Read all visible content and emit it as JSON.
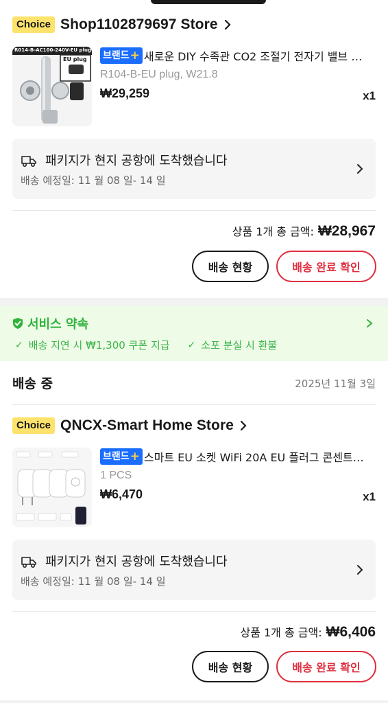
{
  "orders": [
    {
      "choice_badge": "Choice",
      "store_name": "Shop1102879697 Store",
      "brand_label": "브랜드",
      "product_title": "새로운 DIY 수족관 CO2 조절기 전자기 밸브 …",
      "variant": "R104-B-EU plug, W21.8",
      "price": "₩29,259",
      "quantity": "x1",
      "thumb_label": "R014-B-AC100-240V-EU plug",
      "thumb_plug": "EU plug",
      "ship_status": "패키지가 현지 공항에 도착했습니다",
      "ship_eta": "배송 예정일: 11 월 08 일- 14 일",
      "total_label": "상품 1개 총 금액:",
      "total_amount": "₩28,967",
      "track_button": "배송 현황",
      "confirm_button": "배송 완료 확인"
    },
    {
      "choice_badge": "Choice",
      "store_name": "QNCX-Smart Home Store",
      "brand_label": "브랜드",
      "product_title": "스마트 EU 소켓 WiFi 20A EU 플러그 콘센트…",
      "variant": "1 PCS",
      "price": "₩6,470",
      "quantity": "x1",
      "ship_status": "패키지가 현지 공항에 도착했습니다",
      "ship_eta": "배송 예정일: 11 월 08 일- 14 일",
      "total_label": "상품 1개 총 금액:",
      "total_amount": "₩6,406",
      "track_button": "배송 현황",
      "confirm_button": "배송 완료 확인"
    }
  ],
  "service": {
    "title": "서비스 약속",
    "items": [
      "배송 지연 시 ₩1,300 쿠폰 지급",
      "소포 분실 시 환불"
    ]
  },
  "shipping_section": {
    "status": "배송 중",
    "date": "2025년 11월 3일"
  },
  "colors": {
    "choice": "#fde36b",
    "brand": "#1a6dff",
    "service_green": "#2fb33d",
    "confirm_red": "#e02f3e"
  },
  "icons": [
    "chevron-right-icon",
    "truck-icon",
    "shield-check-icon",
    "check-icon"
  ]
}
